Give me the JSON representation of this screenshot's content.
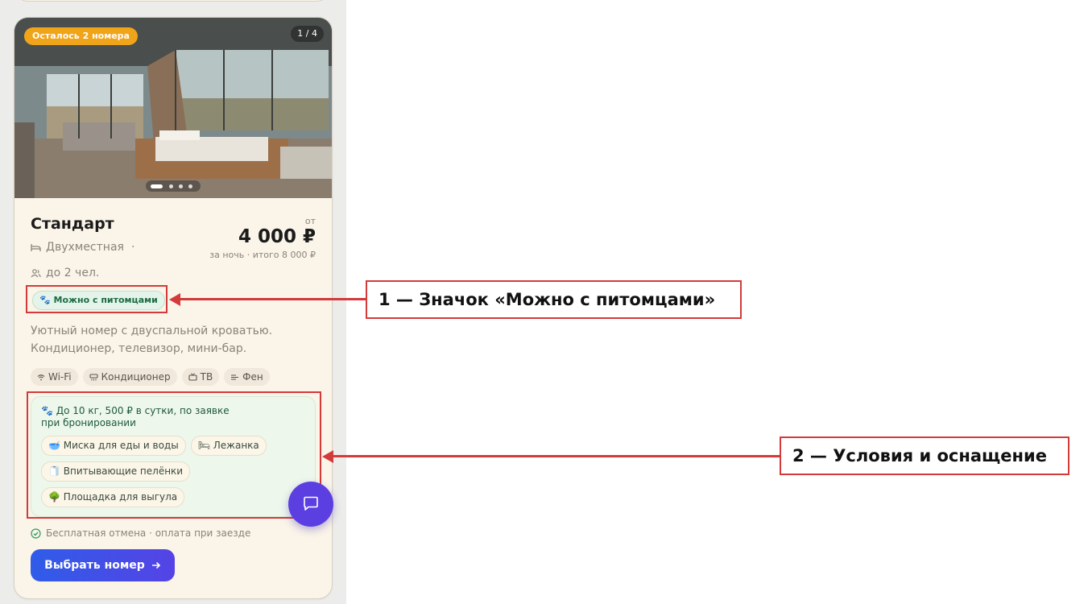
{
  "card": {
    "availability_badge": "Осталось 2 номера",
    "photo_counter": "1 / 4",
    "title": "Стандарт",
    "room_type": "Двухместная",
    "separator": "·",
    "guests": "до 2 чел.",
    "price_prefix": "от",
    "price": "4 000 ₽",
    "price_note": "за ночь · итого 8 000 ₽",
    "pet_badge": "🐾 Можно с питомцами",
    "description": "Уютный номер с двуспальной кроватью. Кондиционер, телевизор, мини-бар.",
    "amenities": [
      {
        "label": "Wi-Fi",
        "icon": "wifi-icon"
      },
      {
        "label": "Кондиционер",
        "icon": "air-conditioner-icon"
      },
      {
        "label": "ТВ",
        "icon": "tv-icon"
      },
      {
        "label": "Фен",
        "icon": "hair-dryer-icon"
      }
    ],
    "pet_conditions": "🐾 До 10 кг, 500 ₽ в сутки, по заявке при бронировании",
    "pet_equipment": [
      "🥣 Миска для еды и воды",
      "🛏 Лежанка",
      "🧻 Впитывающие пелёнки",
      "🌳 Площадка для выгула"
    ],
    "cancellation": "Бесплатная отмена · оплата при заезде",
    "select_button": "Выбрать номер"
  },
  "annotations": {
    "callout_1": "1 — Значок «Можно с питомцами»",
    "callout_2": "2 — Условия и оснащение"
  },
  "colors": {
    "accent": "#5543e6",
    "highlight": "#d33a3a",
    "pet_green": "#1d6b45",
    "badge_orange": "#f0a41a"
  }
}
